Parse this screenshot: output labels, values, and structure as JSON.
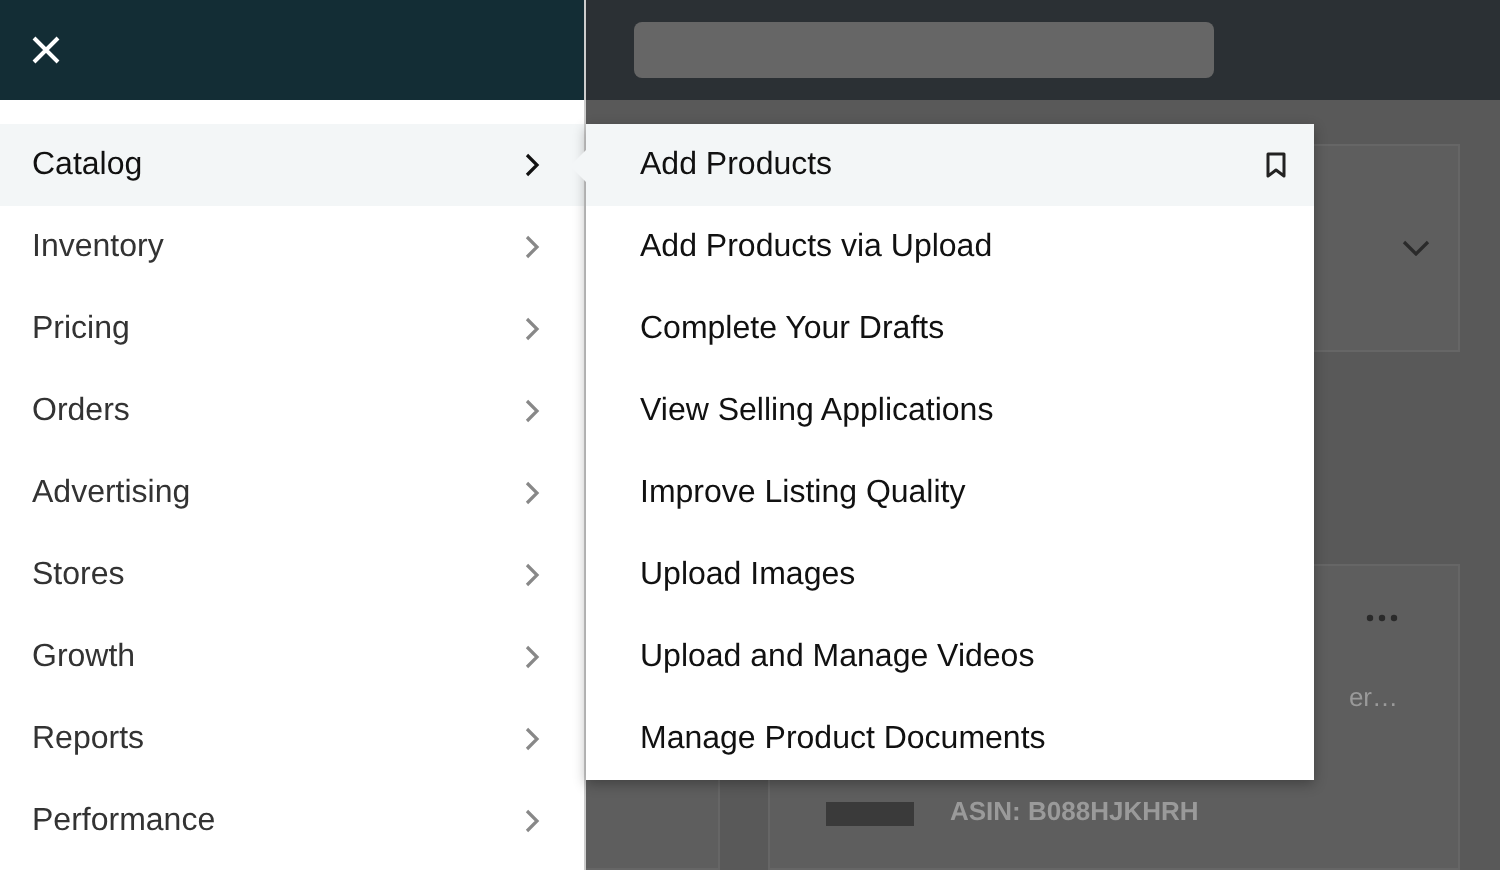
{
  "menu": {
    "items": [
      {
        "label": "Catalog",
        "selected": true
      },
      {
        "label": "Inventory",
        "selected": false
      },
      {
        "label": "Pricing",
        "selected": false
      },
      {
        "label": "Orders",
        "selected": false
      },
      {
        "label": "Advertising",
        "selected": false
      },
      {
        "label": "Stores",
        "selected": false
      },
      {
        "label": "Growth",
        "selected": false
      },
      {
        "label": "Reports",
        "selected": false
      },
      {
        "label": "Performance",
        "selected": false
      }
    ]
  },
  "submenu": {
    "items": [
      {
        "label": "Add Products",
        "selected": true
      },
      {
        "label": "Add Products via Upload",
        "selected": false
      },
      {
        "label": "Complete Your Drafts",
        "selected": false
      },
      {
        "label": "View Selling Applications",
        "selected": false
      },
      {
        "label": "Improve Listing Quality",
        "selected": false
      },
      {
        "label": "Upload Images",
        "selected": false
      },
      {
        "label": "Upload and Manage Videos",
        "selected": false
      },
      {
        "label": "Manage Product Documents",
        "selected": false
      }
    ]
  },
  "background": {
    "product_title": "er…",
    "asin": "ASIN: B088HJKHRH"
  }
}
